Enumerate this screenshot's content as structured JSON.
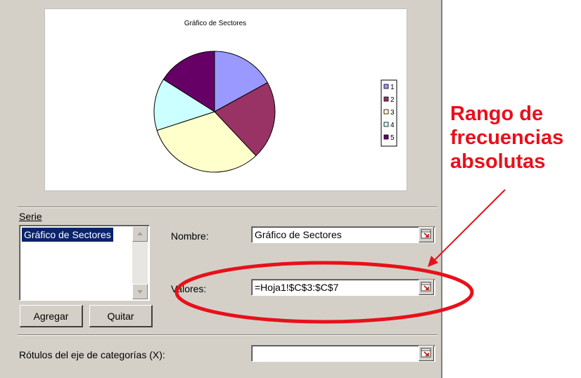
{
  "chart": {
    "title": "Gráfico de Sectores",
    "legend_labels": [
      "1",
      "2",
      "3",
      "4",
      "5"
    ],
    "slice_colors": [
      "#9999ff",
      "#993366",
      "#ffffcc",
      "#ccffff",
      "#660066"
    ]
  },
  "chart_data": {
    "type": "pie",
    "title": "Gráfico de Sectores",
    "categories": [
      "1",
      "2",
      "3",
      "4",
      "5"
    ],
    "values": [
      17,
      21,
      32,
      14,
      16
    ],
    "legend": "right"
  },
  "serie": {
    "label": "Serie",
    "items": [
      "Gráfico de Sectores"
    ]
  },
  "nombre": {
    "label": "Nombre:",
    "value": "Gráfico de Sectores"
  },
  "valores": {
    "label": "Valores:",
    "value": "=Hoja1!$C$3:$C$7"
  },
  "buttons": {
    "agregar": "Agregar",
    "quitar": "Quitar"
  },
  "rotulos": {
    "label": "Rótulos del eje de categorías (X):",
    "value": ""
  },
  "annotation": {
    "lines": [
      "Rango de",
      "frecuencias",
      "absolutas"
    ],
    "color": "#e8101a"
  }
}
